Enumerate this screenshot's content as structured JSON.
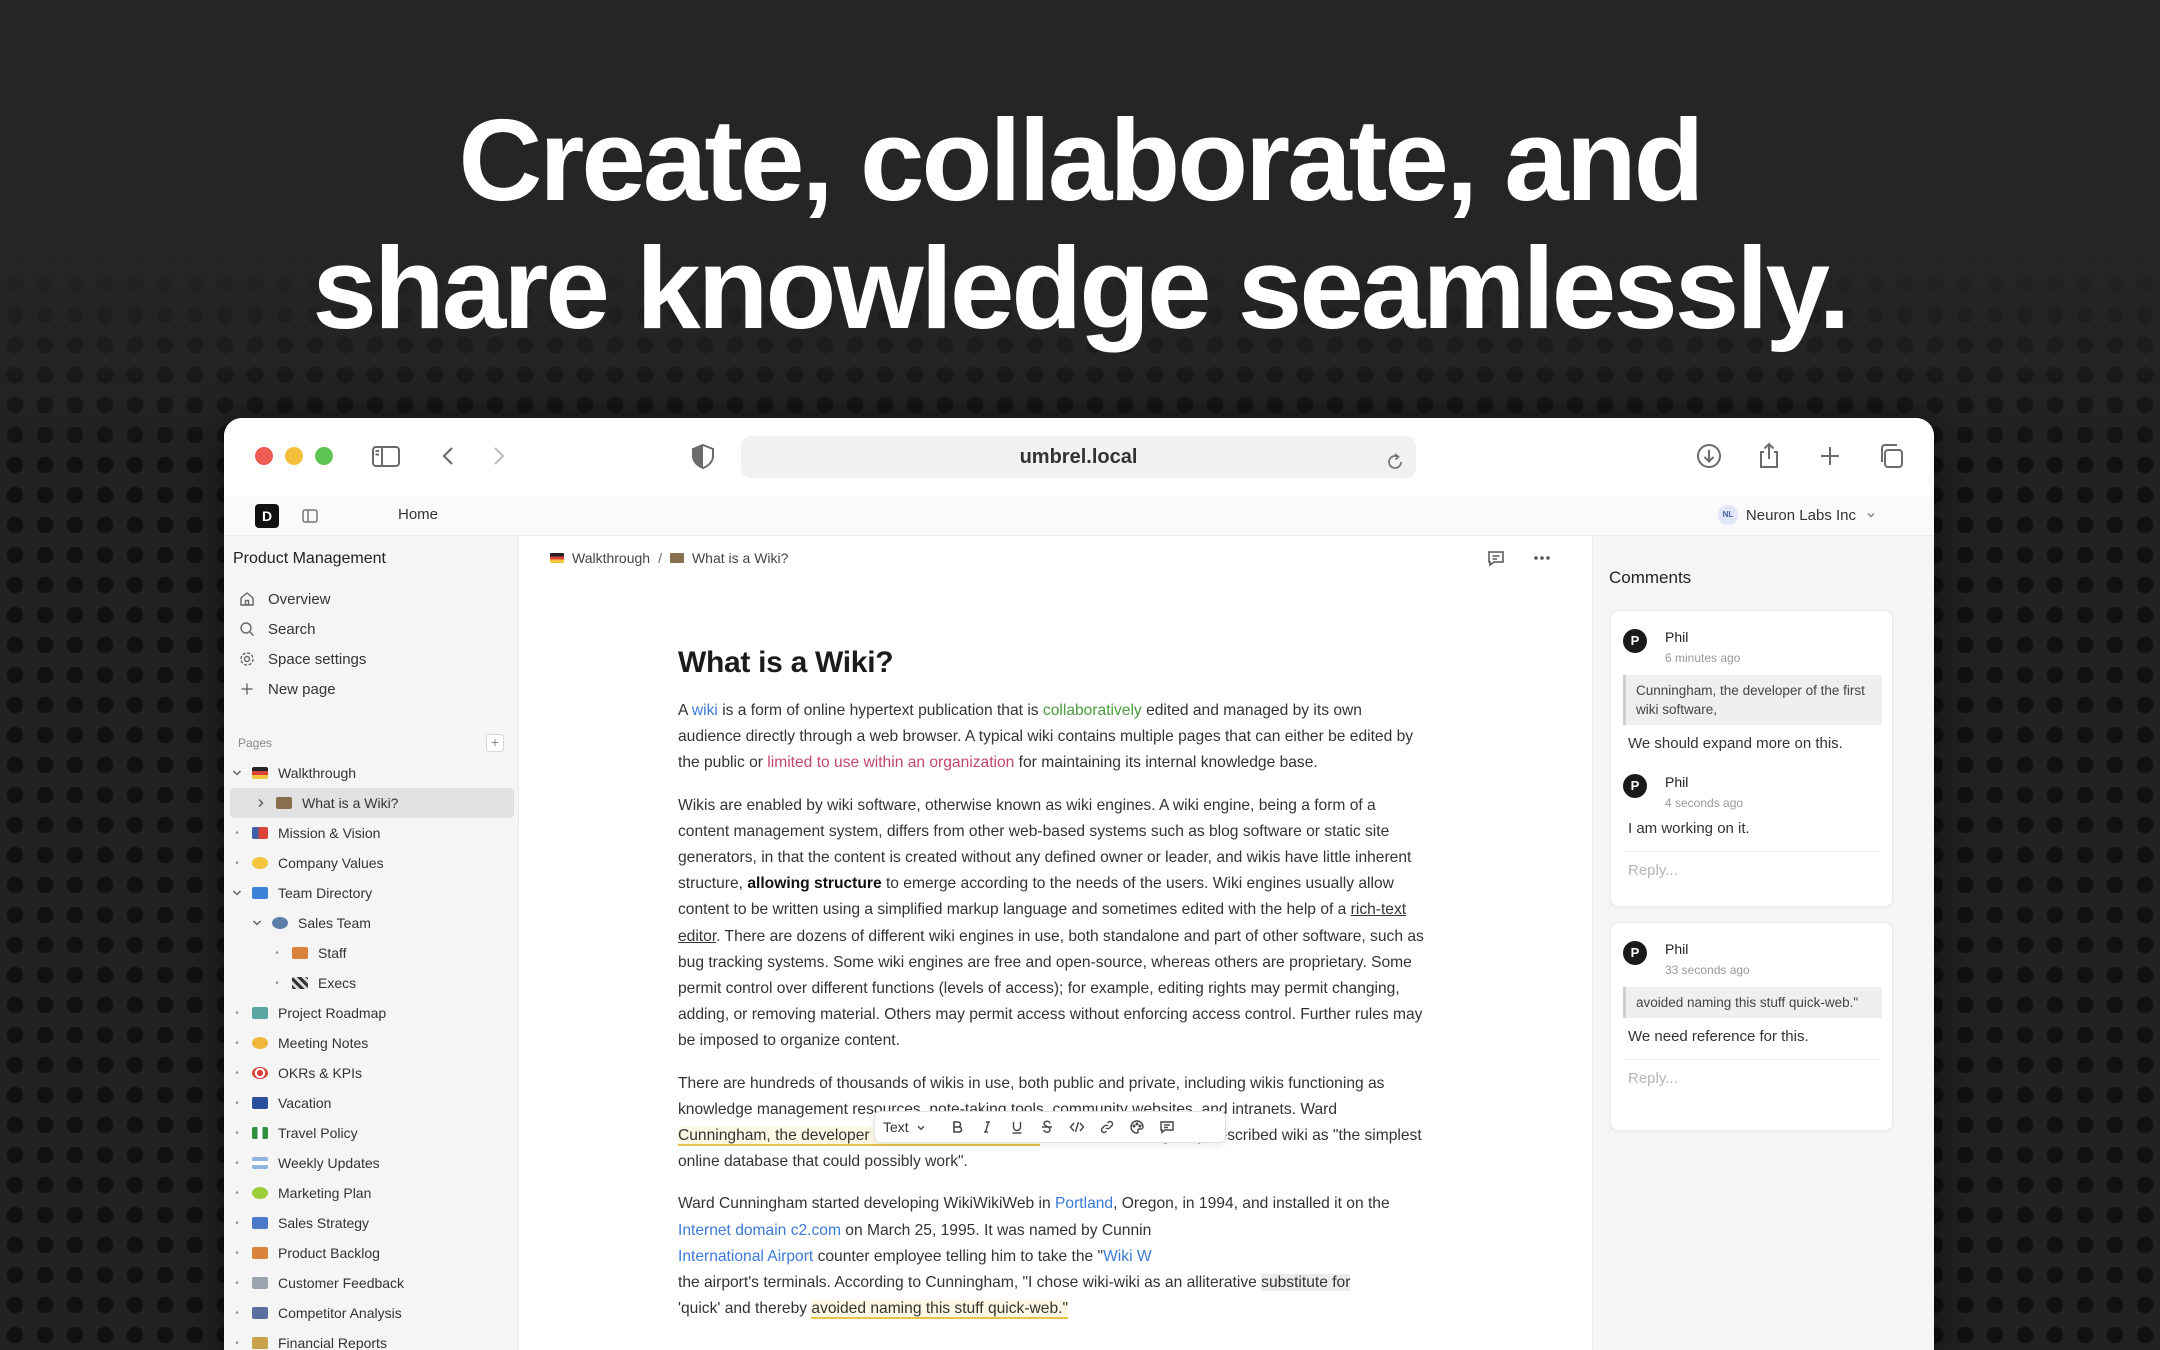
{
  "hero": {
    "line1": "Create, collaborate, and",
    "line2": "share knowledge seamlessly."
  },
  "browser": {
    "url": "umbrel.local",
    "icons": [
      "sidebar-icon",
      "back-icon",
      "forward-icon",
      "shield-icon",
      "reload-icon",
      "download-icon",
      "share-icon",
      "new-tab-icon",
      "tabs-overview-icon"
    ]
  },
  "app": {
    "logo_letter": "D",
    "home_label": "Home",
    "workspace": {
      "avatar": "NL",
      "name": "Neuron Labs Inc"
    }
  },
  "sidebar": {
    "space_title": "Product Management",
    "nav": [
      {
        "label": "Overview",
        "icon": "home-icon"
      },
      {
        "label": "Search",
        "icon": "search-icon"
      },
      {
        "label": "Space settings",
        "icon": "gear-icon"
      },
      {
        "label": "New page",
        "icon": "plus-icon"
      }
    ],
    "pages_label": "Pages",
    "pages": [
      {
        "label": "Walkthrough",
        "expanded": true,
        "color": "#d9433a"
      },
      {
        "label": "What is a Wiki?",
        "color": "#8a6f4e"
      },
      {
        "label": "Mission & Vision",
        "color": "#3e5fa8"
      },
      {
        "label": "Company Values",
        "color": "#f2c53d"
      },
      {
        "label": "Team Directory",
        "expanded": true,
        "color": "#3b82d6"
      },
      {
        "label": "Sales Team",
        "expanded": true,
        "color": "#5f7ea8"
      },
      {
        "label": "Staff",
        "color": "#d9833a"
      },
      {
        "label": "Execs",
        "color": "#444444"
      },
      {
        "label": "Project Roadmap",
        "color": "#5aa6a0"
      },
      {
        "label": "Meeting Notes",
        "color": "#f0b63a"
      },
      {
        "label": "OKRs & KPIs",
        "color": "#d9433a"
      },
      {
        "label": "Vacation",
        "color": "#2a4f9c"
      },
      {
        "label": "Travel Policy",
        "color": "#2f8f3f"
      },
      {
        "label": "Weekly Updates",
        "color": "#8fb6e0"
      },
      {
        "label": "Marketing Plan",
        "color": "#9ccf3a"
      },
      {
        "label": "Sales Strategy",
        "color": "#4a7bc8"
      },
      {
        "label": "Product Backlog",
        "color": "#d9833a"
      },
      {
        "label": "Customer Feedback",
        "color": "#9aa3b0"
      },
      {
        "label": "Competitor Analysis",
        "color": "#5a6f9c"
      },
      {
        "label": "Financial Reports",
        "color": "#c8a24a"
      }
    ]
  },
  "main": {
    "breadcrumb": {
      "parent": "Walkthrough",
      "separator": "/",
      "current": "What is a Wiki?"
    },
    "title": "What is a Wiki?",
    "p1": {
      "a": "A ",
      "wiki": "wiki",
      "b": "  is a form of online hypertext publication that is ",
      "collab": "collaboratively",
      "c": " edited and managed by its own audience directly through a web browser. A typical wiki contains multiple pages that can either be edited by the public or ",
      "limited": "limited to use within an organization",
      "d": " for maintaining its internal knowledge base."
    },
    "p2": {
      "a": "Wikis are enabled by wiki software, otherwise known as wiki engines. A wiki engine, being a form of a content management system, differs from other web-based systems such as blog software or static site generators, in that the content is created without any defined owner or leader, and wikis have little inherent structure, ",
      "bold": "allowing structure",
      "b": " to emerge according to the needs of the users. Wiki engines usually allow content to be written using a simplified markup language and sometimes edited with the help of a ",
      "rte": "rich-text editor",
      "c": ". There are dozens of different wiki engines in use, both standalone and part of other software, such as bug tracking systems. Some wiki engines are free and open-source, whereas others are proprietary. Some permit control over different functions (levels of access); for example, editing rights may permit changing, adding, or removing material. Others may permit access without enforcing access control. Further rules may be imposed to organize content."
    },
    "p3": {
      "a": "There are hundreds of thousands of wikis in use, both public and private, including wikis functioning as knowledge management resources, note-taking tools, community websites, and intranets. Ward ",
      "hl": "Cunningham, the developer of the first wiki software,",
      "b": " WikiWikiWeb, originally described wiki as \"the simplest online database that could possibly work\"."
    },
    "p4": {
      "a": "Ward Cunningham started developing WikiWikiWeb in ",
      "portland": "Portland",
      "b": ", Oregon, in 1994, and installed it on the ",
      "domain": "Internet domain c2.com",
      "c": " on March 25, 1995. It was named by Cunnin",
      "airport": "International Airport",
      "d": " counter employee telling him to take the \"",
      "wikiw": "Wiki W",
      "e": "the airport's terminals. According to Cunningham, \"I chose wiki-wiki as an alliterative ",
      "sel": "substitute for",
      "f": "'quick' and thereby ",
      "hl": "avoided naming this stuff quick-web.\""
    },
    "format_toolbar": {
      "block_type": "Text"
    }
  },
  "comments": {
    "title": "Comments",
    "threads": [
      {
        "items": [
          {
            "author": "Phil",
            "time": "6 minutes ago",
            "quote": "Cunningham, the developer of the first wiki software,",
            "body": "We should expand more on this."
          },
          {
            "author": "Phil",
            "time": "4 seconds ago",
            "body": "I am working on it."
          }
        ],
        "reply_placeholder": "Reply..."
      },
      {
        "items": [
          {
            "author": "Phil",
            "time": "33 seconds ago",
            "quote": "avoided naming this stuff quick-web.\"",
            "body": "We need reference for this."
          }
        ],
        "reply_placeholder": "Reply..."
      }
    ]
  }
}
